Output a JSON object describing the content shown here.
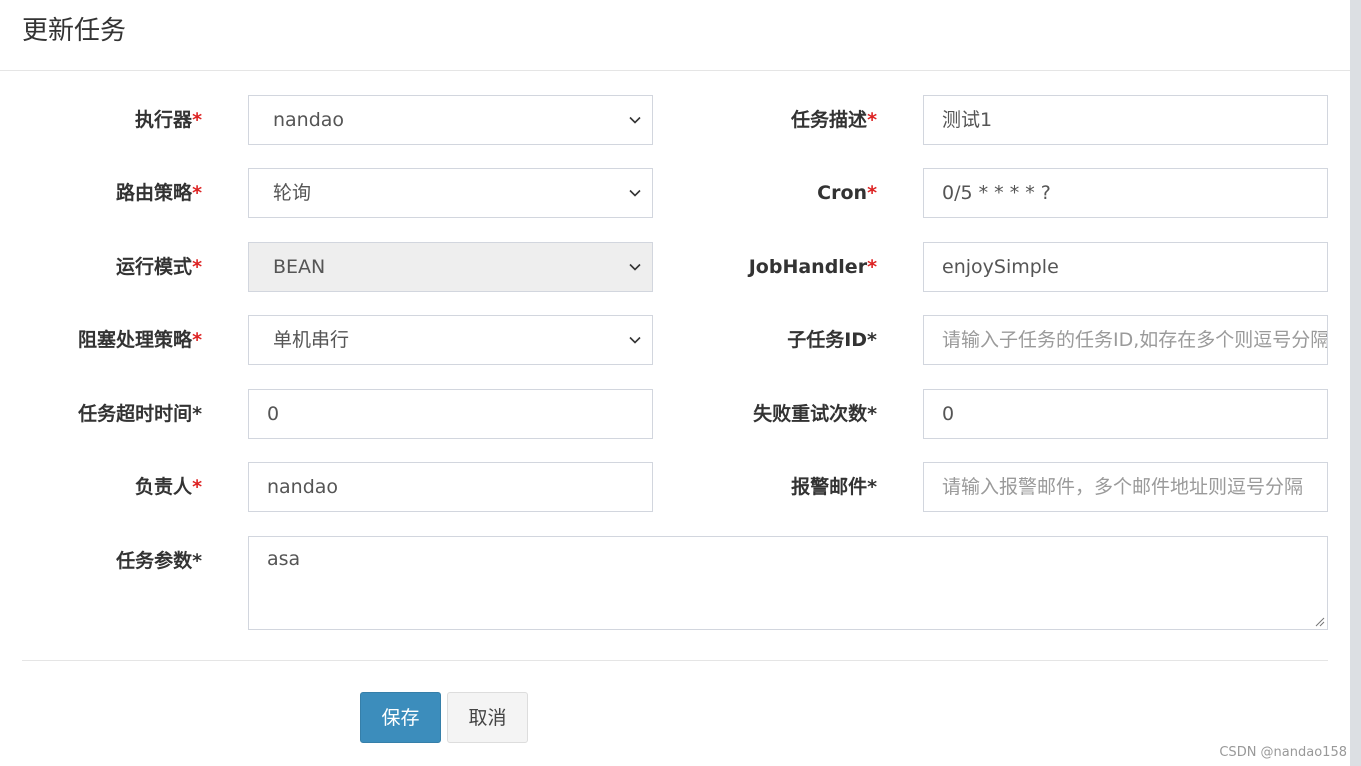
{
  "modal": {
    "title": "更新任务"
  },
  "form": {
    "executor": {
      "label": "执行器",
      "required_mark": "*",
      "value": "nandao"
    },
    "job_desc": {
      "label": "任务描述",
      "required_mark": "*",
      "value": "测试1"
    },
    "route_strategy": {
      "label": "路由策略",
      "required_mark": "*",
      "value": "轮询"
    },
    "cron": {
      "label": "Cron",
      "required_mark": "*",
      "value": "0/5 * * * * ?"
    },
    "glue_type": {
      "label": "运行模式",
      "required_mark": "*",
      "value": "BEAN"
    },
    "job_handler": {
      "label": "JobHandler",
      "required_mark": "*",
      "value": "enjoySimple"
    },
    "block_strategy": {
      "label": "阻塞处理策略",
      "required_mark": "*",
      "value": "单机串行"
    },
    "child_job_id": {
      "label": "子任务ID*",
      "value": "",
      "placeholder": "请输入子任务的任务ID,如存在多个则逗号分隔"
    },
    "timeout": {
      "label": "任务超时时间*",
      "value": "0"
    },
    "fail_retry": {
      "label": "失败重试次数*",
      "value": "0"
    },
    "author": {
      "label": "负责人",
      "required_mark": "*",
      "value": "nandao"
    },
    "alarm_email": {
      "label": "报警邮件*",
      "value": "",
      "placeholder": "请输入报警邮件，多个邮件地址则逗号分隔"
    },
    "param": {
      "label": "任务参数*",
      "value": "asa"
    }
  },
  "buttons": {
    "save": "保存",
    "cancel": "取消"
  },
  "watermark": "CSDN @nandao158",
  "colors": {
    "primary": "#3c8dbc",
    "required": "#dd2222"
  }
}
